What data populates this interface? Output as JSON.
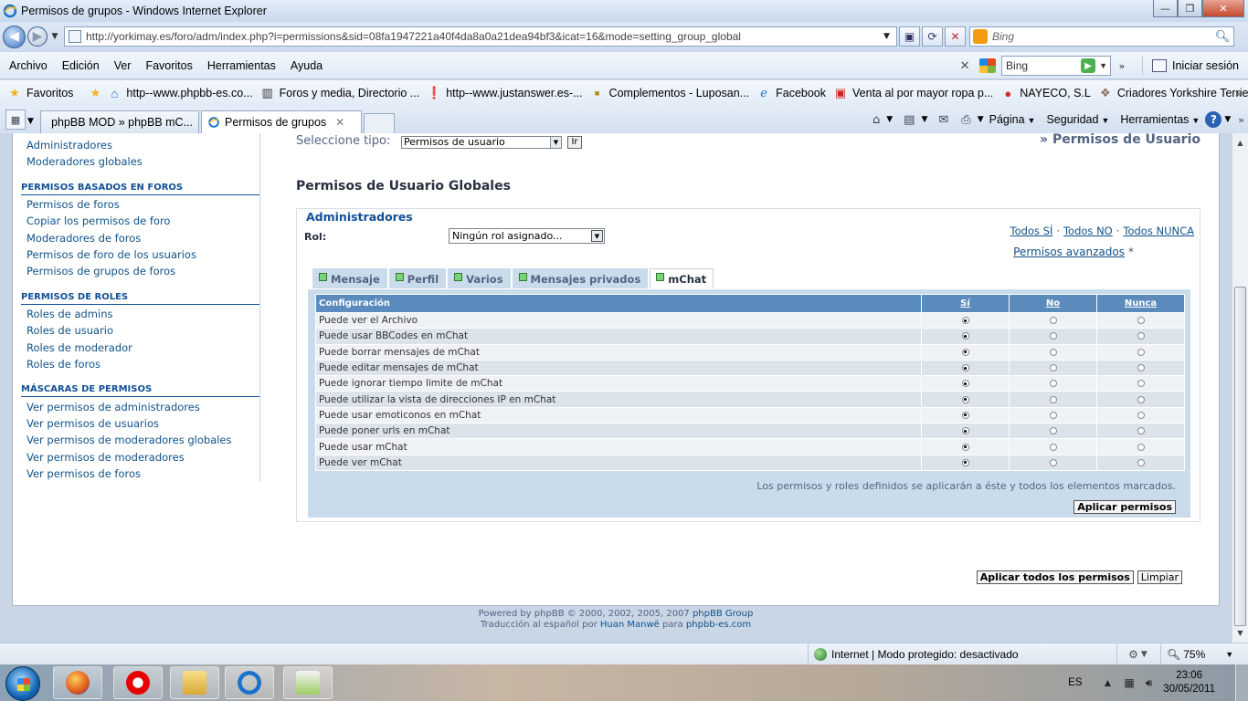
{
  "window": {
    "title": "Permisos de grupos - Windows Internet Explorer",
    "minimize": "—",
    "maximize": "❐",
    "close": "✕"
  },
  "addressbar": {
    "url": "http://yorkimay.es/foro/adm/index.php?i=permissions&sid=08fa1947221a40f4da8a0a21dea94bf3&icat=16&mode=setting_group_global",
    "search_placeholder": "Bing"
  },
  "menubar": {
    "items": [
      "Archivo",
      "Edición",
      "Ver",
      "Favoritos",
      "Herramientas",
      "Ayuda"
    ],
    "bing_box": "Bing",
    "signin": "Iniciar sesión"
  },
  "favorites": {
    "label": "Favoritos",
    "items": [
      "http--www.phpbb-es.co...",
      "Foros y media, Directorio ...",
      "http--www.justanswer.es-...",
      "Complementos - Luposan...",
      "Facebook",
      "Venta al por mayor ropa p...",
      "NAYECO, S.L",
      "Criadores Yorkshire Terrie..."
    ]
  },
  "tabs": {
    "items": [
      "phpBB MOD » phpBB mC...",
      "Permisos de grupos"
    ],
    "active_index": 1
  },
  "commandbar": {
    "pagina": "Página",
    "seguridad": "Seguridad",
    "herramientas": "Herramientas"
  },
  "sidebar": {
    "top_links": [
      "Administradores",
      "Moderadores globales"
    ],
    "sections": [
      {
        "heading": "PERMISOS BASADOS EN FOROS",
        "links": [
          "Permisos de foros",
          "Copiar los permisos de foro",
          "Moderadores de foros",
          "Permisos de foro de los usuarios",
          "Permisos de grupos de foros"
        ]
      },
      {
        "heading": "PERMISOS DE ROLES",
        "links": [
          "Roles de admins",
          "Roles de usuario",
          "Roles de moderador",
          "Roles de foros"
        ]
      },
      {
        "heading": "MÁSCARAS DE PERMISOS",
        "links": [
          "Ver permisos de administradores",
          "Ver permisos de usuarios",
          "Ver permisos de moderadores globales",
          "Ver permisos de moderadores",
          "Ver permisos de foros"
        ]
      }
    ]
  },
  "main": {
    "select_type_label": "Seleccione tipo:",
    "select_type_value": "Permisos de usuario",
    "go_button": "Ir",
    "breadcrumb": "» Permisos de Usuario",
    "page_title": "Permisos de Usuario Globales",
    "group": {
      "legend": "Administradores",
      "role_label": "Rol:",
      "role_value": "Ningún rol asignado...",
      "quick_all_yes": "Todos SÍ",
      "quick_all_no": "Todos NO",
      "quick_all_never": "Todos NUNCA",
      "advanced_link": "Permisos avanzados",
      "advanced_asterisk": "*",
      "tabs": [
        "Mensaje",
        "Perfil",
        "Varios",
        "Mensajes privados",
        "mChat"
      ],
      "active_tab": 4,
      "table": {
        "headers": [
          "Configuración",
          "Sí",
          "No",
          "Nunca"
        ],
        "rows": [
          {
            "label": "Puede ver el Archivo",
            "value": "yes"
          },
          {
            "label": "Puede usar BBCodes en mChat",
            "value": "yes"
          },
          {
            "label": "Puede borrar mensajes de mChat",
            "value": "yes"
          },
          {
            "label": "Puede editar mensajes de mChat",
            "value": "yes"
          },
          {
            "label": "Puede ignorar tiempo limite de mChat",
            "value": "yes"
          },
          {
            "label": "Puede utilizar la vista de direcciones IP en mChat",
            "value": "yes"
          },
          {
            "label": "Puede usar emoticonos en mChat",
            "value": "yes"
          },
          {
            "label": "Puede poner urls en mChat",
            "value": "yes"
          },
          {
            "label": "Puede usar mChat",
            "value": "yes"
          },
          {
            "label": "Puede ver mChat",
            "value": "yes"
          }
        ]
      },
      "note": "Los permisos y roles definidos se aplicarán a éste y todos los elementos marcados.",
      "apply_button": "Aplicar permisos"
    },
    "apply_all_button": "Aplicar todos los permisos",
    "reset_button": "Limpiar"
  },
  "footer": {
    "line1_pre": "Powered by phpBB © 2000, 2002, 2005, 2007 ",
    "line1_link": "phpBB Group",
    "line2_pre": "Traducción al español por ",
    "line2_link1": "Huan Manwë",
    "line2_mid": " para ",
    "line2_link2": "phpbb-es.com"
  },
  "statusbar": {
    "zone": "Internet | Modo protegido: desactivado",
    "zoom": "75%"
  },
  "taskbar": {
    "lang": "ES",
    "time": "23:06",
    "date": "30/05/2011"
  }
}
